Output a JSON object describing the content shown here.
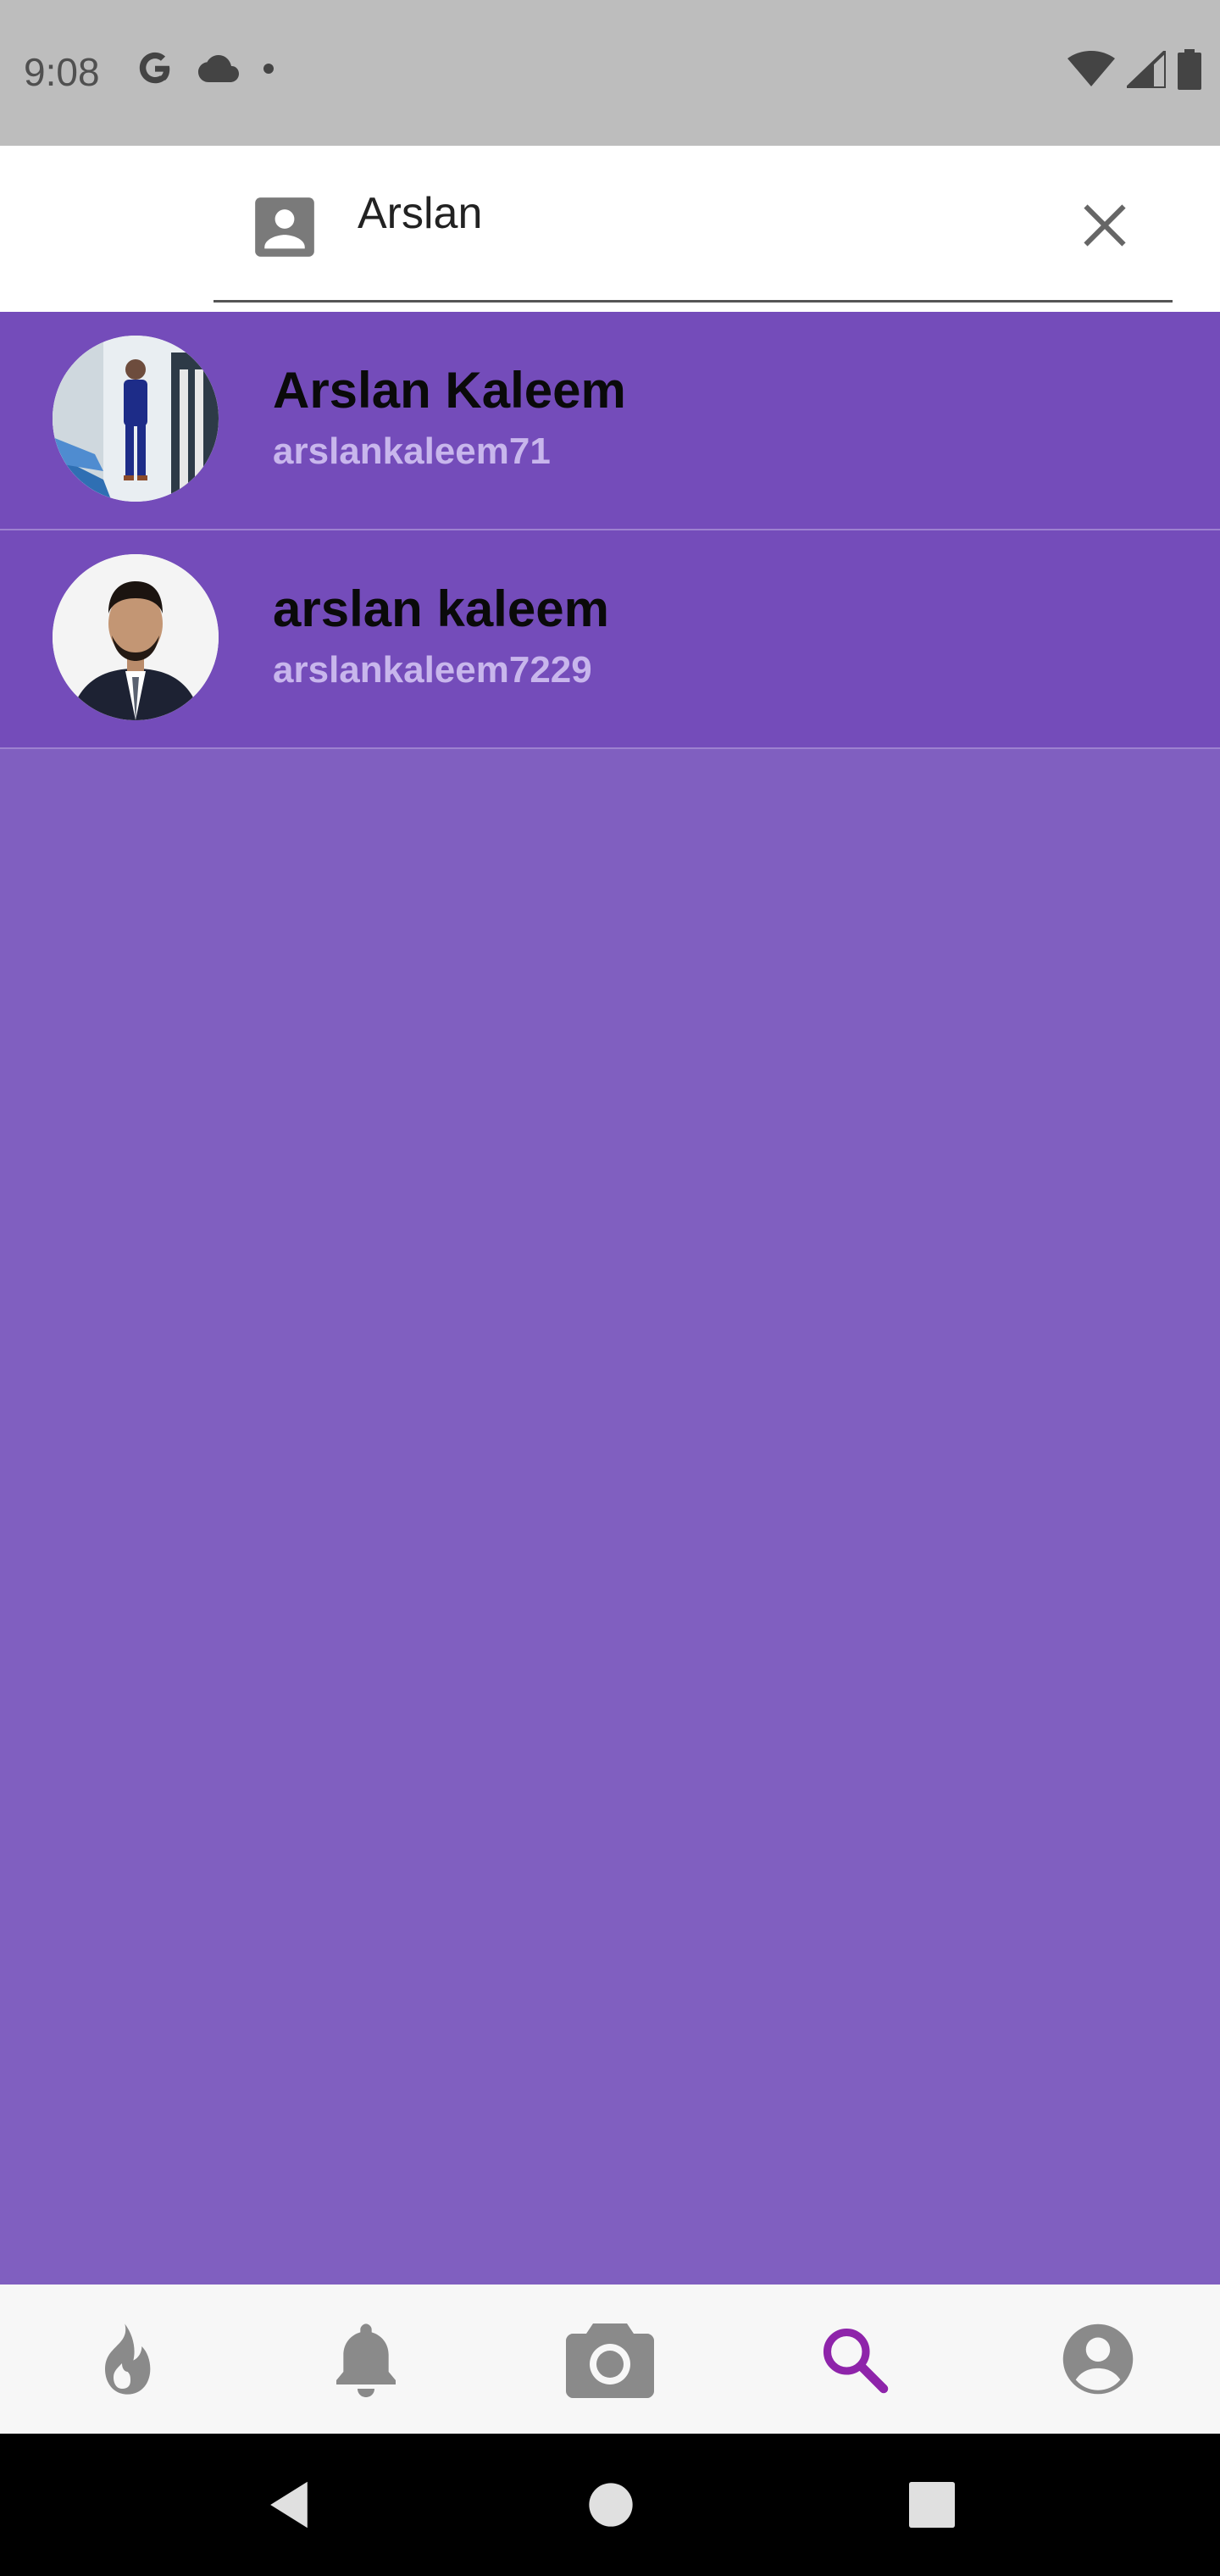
{
  "status_bar": {
    "time": "9:08",
    "icons": [
      "google-icon",
      "cloud-icon",
      "dot-icon",
      "wifi-icon",
      "signal-icon",
      "battery-icon"
    ]
  },
  "search": {
    "value": "Arslan",
    "placeholder": "",
    "leading_icon": "contact-icon",
    "clear_icon": "close-icon"
  },
  "results": [
    {
      "name": "Arslan Kaleem",
      "username": "arslankaleem71"
    },
    {
      "name": "arslan kaleem",
      "username": "arslankaleem7229"
    }
  ],
  "bottom_nav": {
    "items": [
      "flame-icon",
      "bell-icon",
      "camera-icon",
      "search-icon",
      "account-icon"
    ],
    "active": "search-icon",
    "active_color": "#8e24aa",
    "inactive_color": "#8a8a8a"
  },
  "colors": {
    "background": "#805fc0",
    "row": "#744cba",
    "username": "#c8b6ec"
  }
}
